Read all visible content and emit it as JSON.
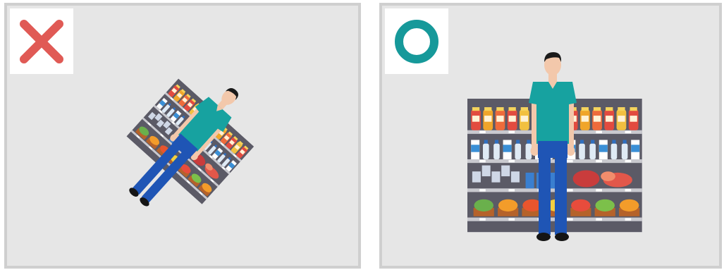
{
  "panels": [
    {
      "verdict": "incorrect",
      "symbol": "x-mark-icon",
      "symbol_color": "#e05a55",
      "orientation": "rotated"
    },
    {
      "verdict": "correct",
      "symbol": "circle-o-icon",
      "symbol_color": "#16999a",
      "orientation": "upright"
    }
  ],
  "colors": {
    "panel_bg": "#e6e6e6",
    "panel_border": "#cfcfcf",
    "shelf_unit": "#5b5a66",
    "shirt": "#17a2a0",
    "trousers": "#1f55b5",
    "skin": "#f3c8ab",
    "hair": "#1a1a1a"
  }
}
